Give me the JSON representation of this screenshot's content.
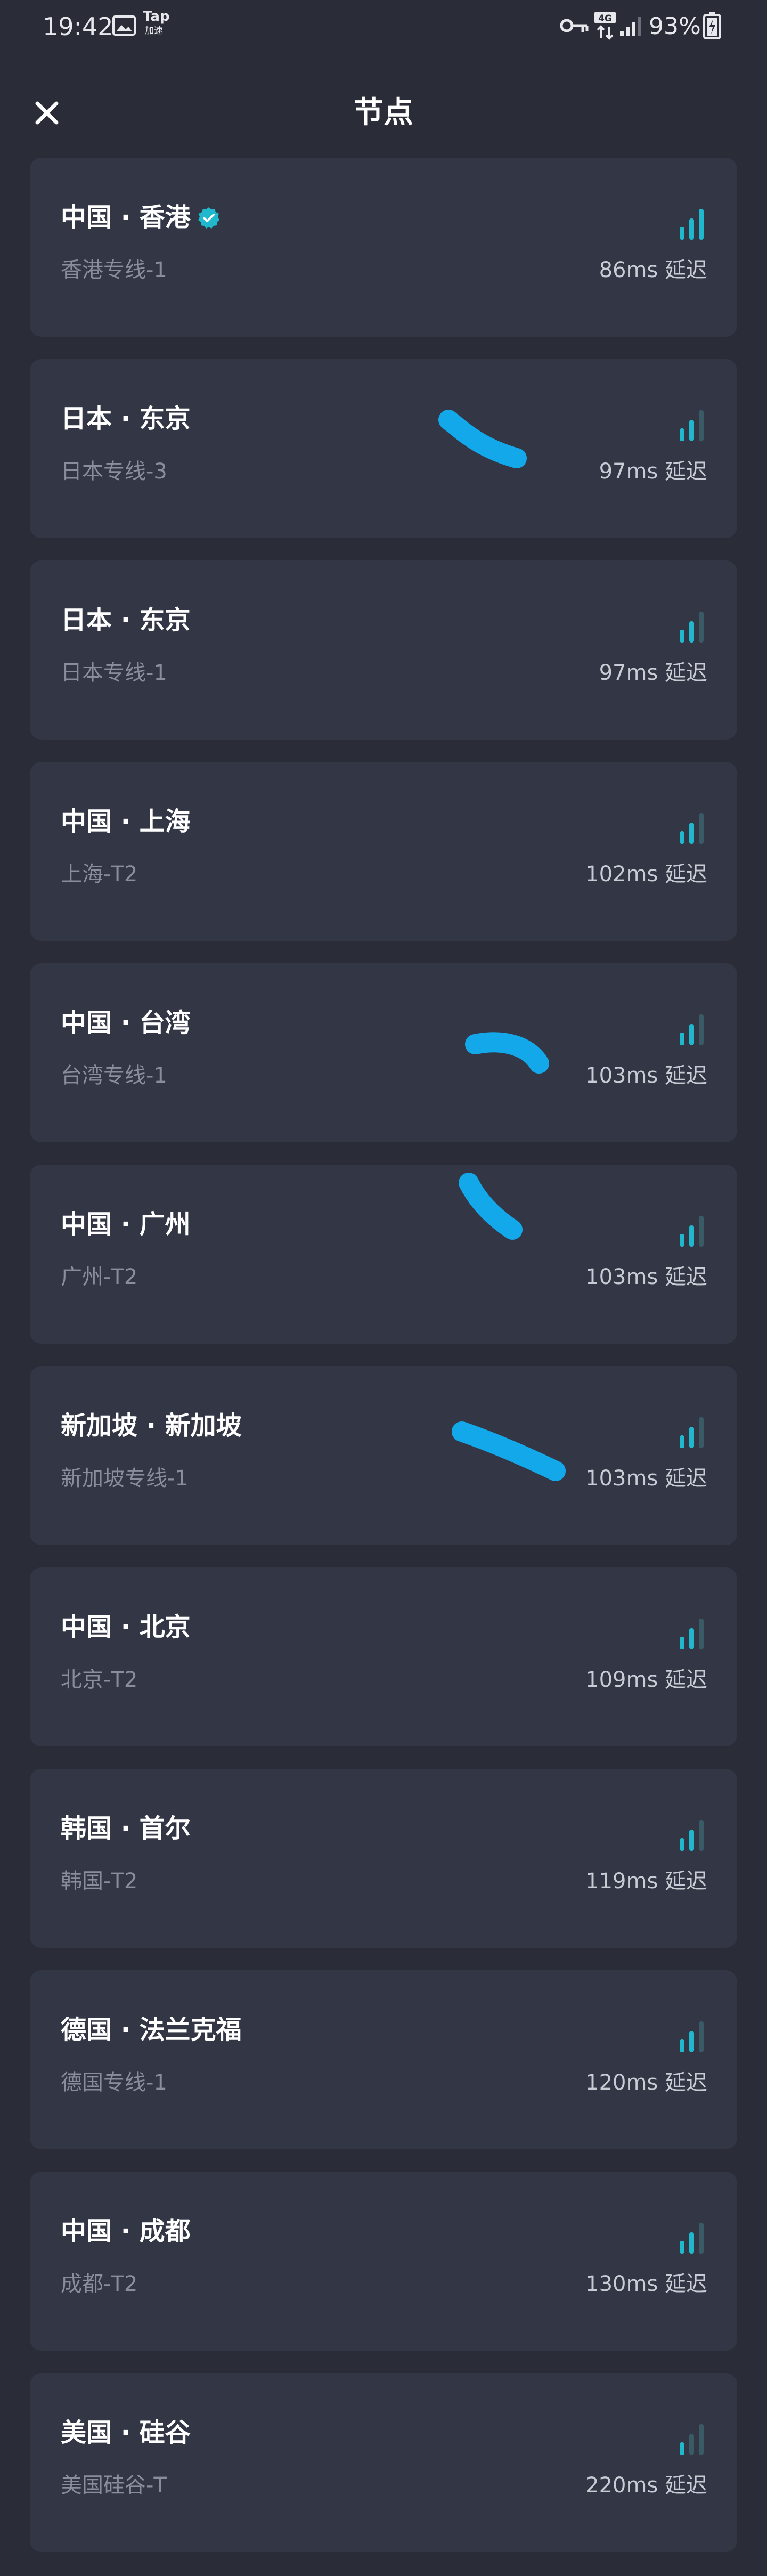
{
  "status_bar": {
    "time": "19:42",
    "tap_label_top": "Tap",
    "tap_label_bottom": "加速",
    "network_type": "4G",
    "battery_percent": "93%",
    "icons": [
      "gallery-icon",
      "tap-accelerator-icon",
      "vpn-key-icon",
      "mobile-data-icon",
      "signal-icon",
      "battery-icon"
    ]
  },
  "header": {
    "title": "节点",
    "close_icon": "close-icon"
  },
  "colors": {
    "background": "#2a2d38",
    "card": "#333745",
    "accent": "#1fb8cc",
    "signal_dim": "#3a5a66",
    "scribble": "#12a8ea"
  },
  "nodes": [
    {
      "title": "中国 · 香港",
      "subtitle": "香港专线-1",
      "latency": "86ms 延迟",
      "verified": true,
      "signal_bars": 3
    },
    {
      "title": "日本 · 东京",
      "subtitle": "日本专线-3",
      "latency": "97ms 延迟",
      "verified": false,
      "signal_bars": 2
    },
    {
      "title": "日本 · 东京",
      "subtitle": "日本专线-1",
      "latency": "97ms 延迟",
      "verified": false,
      "signal_bars": 2
    },
    {
      "title": "中国 · 上海",
      "subtitle": "上海-T2",
      "latency": "102ms 延迟",
      "verified": false,
      "signal_bars": 2
    },
    {
      "title": "中国 · 台湾",
      "subtitle": "台湾专线-1",
      "latency": "103ms 延迟",
      "verified": false,
      "signal_bars": 2
    },
    {
      "title": "中国 · 广州",
      "subtitle": "广州-T2",
      "latency": "103ms 延迟",
      "verified": false,
      "signal_bars": 2
    },
    {
      "title": "新加坡 · 新加坡",
      "subtitle": "新加坡专线-1",
      "latency": "103ms 延迟",
      "verified": false,
      "signal_bars": 2
    },
    {
      "title": "中国 · 北京",
      "subtitle": "北京-T2",
      "latency": "109ms 延迟",
      "verified": false,
      "signal_bars": 2
    },
    {
      "title": "韩国 · 首尔",
      "subtitle": "韩国-T2",
      "latency": "119ms 延迟",
      "verified": false,
      "signal_bars": 2
    },
    {
      "title": "德国 · 法兰克福",
      "subtitle": "德国专线-1",
      "latency": "120ms 延迟",
      "verified": false,
      "signal_bars": 2
    },
    {
      "title": "中国 · 成都",
      "subtitle": "成都-T2",
      "latency": "130ms 延迟",
      "verified": false,
      "signal_bars": 2
    },
    {
      "title": "美国 · 硅谷",
      "subtitle": "美国硅谷-T",
      "latency": "220ms 延迟",
      "verified": false,
      "signal_bars": 1
    }
  ]
}
